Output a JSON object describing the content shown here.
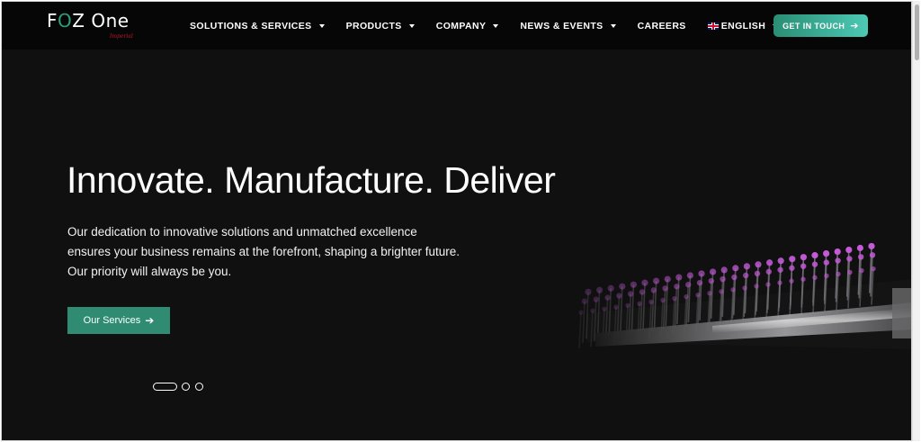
{
  "header": {
    "logo": {
      "text": "FOZ One",
      "sub": "Imperial"
    },
    "nav": [
      {
        "label": "SOLUTIONS & SERVICES",
        "has_caret": true
      },
      {
        "label": "PRODUCTS",
        "has_caret": true
      },
      {
        "label": "COMPANY",
        "has_caret": true
      },
      {
        "label": "NEWS & EVENTS",
        "has_caret": true
      },
      {
        "label": "CAREERS",
        "has_caret": false
      },
      {
        "label": "ENGLISH",
        "has_caret": true,
        "icon": "uk-flag-icon"
      }
    ],
    "cta_label": "GET IN TOUCH",
    "cta_icon": "arrow-right-icon"
  },
  "hero": {
    "title": "Innovate. Manufacture. Deliver",
    "text": "Our dedication to innovative solutions and unmatched excellence ensures your business remains at the forefront, shaping a brighter future. Our priority will always be you.",
    "button_label": "Our Services",
    "button_icon": "arrow-right-icon",
    "slides": {
      "count": 3,
      "active": 1
    }
  },
  "colors": {
    "background": "#101010",
    "header": "#060606",
    "accent": "#2f8c72",
    "cta_gradient_start": "#2a8e74",
    "cta_gradient_end": "#4cc9b5",
    "logo_ring": "#2f9e77",
    "machine_tips": "#c45ad8"
  }
}
